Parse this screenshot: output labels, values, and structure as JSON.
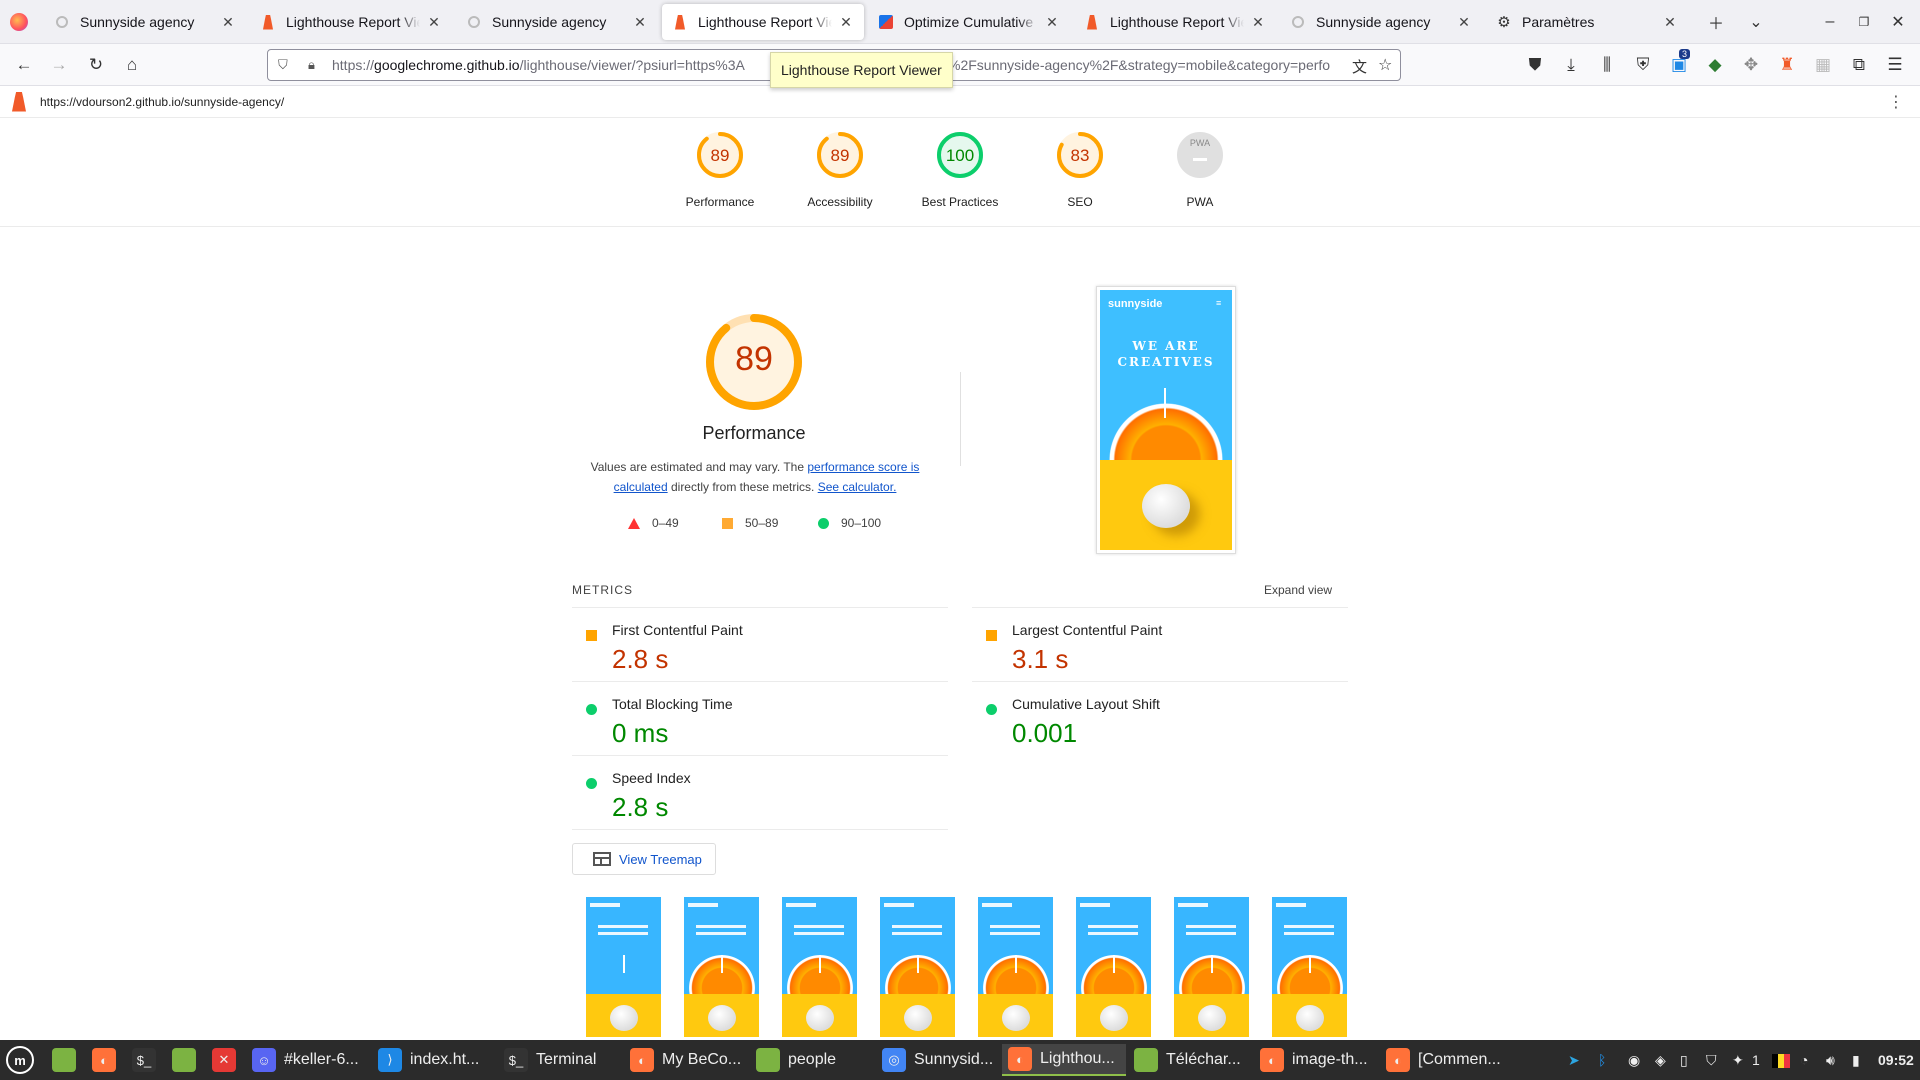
{
  "browser": {
    "tabs": [
      {
        "title": "Sunnyside agency",
        "icon": "sunnyside-favicon"
      },
      {
        "title": "Lighthouse Report Viewer",
        "icon": "lighthouse-favicon"
      },
      {
        "title": "Sunnyside agency",
        "icon": "sunnyside-favicon"
      },
      {
        "title": "Lighthouse Report Viewer",
        "icon": "lighthouse-favicon",
        "active": true
      },
      {
        "title": "Optimize Cumulative Layout Shift",
        "icon": "webdev-favicon"
      },
      {
        "title": "Lighthouse Report Viewer",
        "icon": "lighthouse-favicon"
      },
      {
        "title": "Sunnyside agency",
        "icon": "sunnyside-favicon"
      },
      {
        "title": "Paramètres",
        "icon": "gear-icon"
      }
    ],
    "url_prefix": "https://",
    "url_host": "googlechrome.github.io",
    "url_rest": "/lighthouse/viewer/?psiurl=https%3A%2F%2Fvdourson2.github.io%2Fsunnyside-agency%2F&strategy=mobile&category=performance",
    "url_visible_start": "/lighthouse/viewer/?psiurl=https%3A",
    "url_visible_end": "%2Fsunnyside-agency%2F&strategy=mobile&category=perfo",
    "tooltip": "Lighthouse Report Viewer",
    "extension_badge": "3"
  },
  "report": {
    "tested_url": "https://vdourson2.github.io/sunnyside-agency/",
    "scores": [
      {
        "label": "Performance",
        "value": "89",
        "level": "average"
      },
      {
        "label": "Accessibility",
        "value": "89",
        "level": "average"
      },
      {
        "label": "Best Practices",
        "value": "100",
        "level": "pass"
      },
      {
        "label": "SEO",
        "value": "83",
        "level": "average"
      },
      {
        "label": "PWA",
        "value": "PWA",
        "level": "na"
      }
    ],
    "main_score": "89",
    "main_title": "Performance",
    "desc_pre": "Values are estimated and may vary. The ",
    "desc_link1": "performance score is calculated",
    "desc_mid": " directly from these metrics. ",
    "desc_link2": "See calculator.",
    "legend": [
      {
        "range": "0–49",
        "shape": "triangle",
        "color": "#ff3333"
      },
      {
        "range": "50–89",
        "shape": "square",
        "color": "#ffaa33"
      },
      {
        "range": "90–100",
        "shape": "circle",
        "color": "#0cce6b"
      }
    ],
    "metrics_title": "METRICS",
    "expand_label": "Expand view",
    "metrics": [
      {
        "name": "First Contentful Paint",
        "value": "2.8 s",
        "level": "average"
      },
      {
        "name": "Largest Contentful Paint",
        "value": "3.1 s",
        "level": "average"
      },
      {
        "name": "Total Blocking Time",
        "value": "0 ms",
        "level": "pass"
      },
      {
        "name": "Cumulative Layout Shift",
        "value": "0.001",
        "level": "pass"
      },
      {
        "name": "Speed Index",
        "value": "2.8 s",
        "level": "pass"
      }
    ],
    "treemap_label": "View Treemap",
    "screenshot_brand": "sunnyside",
    "screenshot_heading": "WE ARE CREATIVES",
    "thumbnail_count": 8
  },
  "taskbar": {
    "items": [
      {
        "label": "",
        "icon": "files-icon",
        "color": "#7cb342"
      },
      {
        "label": "",
        "icon": "firefox-icon",
        "color": "#ff7139"
      },
      {
        "label": "",
        "icon": "terminal-icon",
        "color": "#333"
      },
      {
        "label": "",
        "icon": "folder-icon",
        "color": "#7cb342"
      },
      {
        "label": "",
        "icon": "xmind-icon",
        "color": "#e53935"
      },
      {
        "label": "#keller-6...",
        "icon": "discord-icon",
        "color": "#5865f2"
      },
      {
        "label": "index.ht...",
        "icon": "vscode-icon",
        "color": "#1e88e5"
      },
      {
        "label": "Terminal",
        "icon": "terminal-icon",
        "color": "#333"
      },
      {
        "label": "My BeCo...",
        "icon": "firefox-icon",
        "color": "#ff7139"
      },
      {
        "label": "people",
        "icon": "folder-icon",
        "color": "#7cb342"
      },
      {
        "label": "Sunnysid...",
        "icon": "chromium-icon",
        "color": "#4285f4"
      },
      {
        "label": "Lighthou...",
        "icon": "firefox-icon",
        "color": "#ff7139",
        "active": true
      },
      {
        "label": "Téléchar...",
        "icon": "folder-icon",
        "color": "#7cb342"
      },
      {
        "label": "image-th...",
        "icon": "firefox-icon",
        "color": "#ff7139"
      },
      {
        "label": "[Commen...",
        "icon": "firefox-icon",
        "color": "#ff7139"
      }
    ],
    "workspace": "1",
    "clock": "09:52"
  }
}
